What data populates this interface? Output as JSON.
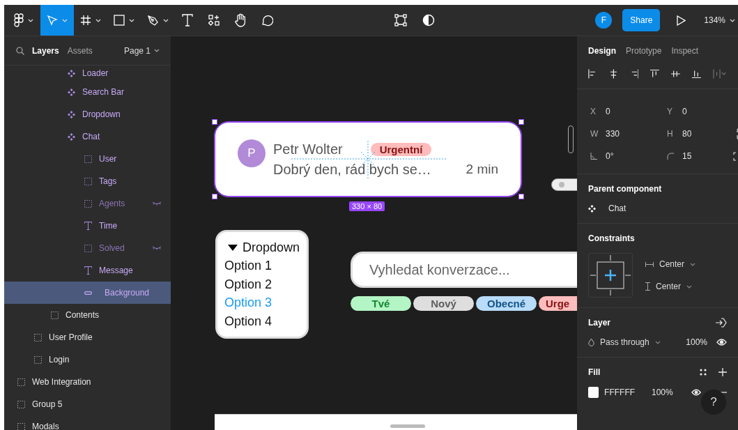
{
  "toolbar": {
    "tools": [
      {
        "kind": "main-menu",
        "menu": true,
        "selected": false
      },
      {
        "kind": "move",
        "menu": true,
        "selected": true
      },
      {
        "kind": "frame",
        "menu": true,
        "selected": false
      },
      {
        "kind": "shape",
        "menu": true,
        "selected": false
      },
      {
        "kind": "pen",
        "menu": true,
        "selected": false
      },
      {
        "kind": "text",
        "menu": false,
        "selected": false
      },
      {
        "kind": "resources",
        "menu": false,
        "selected": false
      },
      {
        "kind": "hand",
        "menu": false,
        "selected": false
      },
      {
        "kind": "comment",
        "menu": false,
        "selected": false
      }
    ],
    "user_initial": "F",
    "share_label": "Share",
    "zoom": "134%"
  },
  "sidebar": {
    "tabs": [
      {
        "label": "Layers",
        "selected": true
      },
      {
        "label": "Assets",
        "selected": false
      }
    ],
    "page": "Page 1",
    "layers": [
      {
        "children": [
          {
            "children": [
              {
                "children": [
                  {
                    "name": "Loader",
                    "kind": "component",
                    "hidden": false,
                    "selected": false
                  },
                  {
                    "name": "Search Bar",
                    "kind": "component",
                    "hidden": false,
                    "selected": false
                  },
                  {
                    "name": "Dropdown",
                    "kind": "component",
                    "hidden": false,
                    "selected": false
                  },
                  {
                    "name": "Chat",
                    "kind": "component",
                    "hidden": false,
                    "selected": false,
                    "children": [
                      {
                        "name": "User",
                        "kind": "frame",
                        "hidden": false,
                        "selected": false
                      },
                      {
                        "name": "Tags",
                        "kind": "frame",
                        "hidden": false,
                        "selected": false
                      },
                      {
                        "name": "Agents",
                        "kind": "frame",
                        "hidden": true,
                        "selected": false
                      },
                      {
                        "name": "Time",
                        "kind": "text",
                        "hidden": false,
                        "selected": false
                      },
                      {
                        "name": "Solved",
                        "kind": "frame",
                        "hidden": true,
                        "selected": false
                      },
                      {
                        "name": "Message",
                        "kind": "text",
                        "hidden": false,
                        "selected": false
                      },
                      {
                        "name": "Background",
                        "kind": "rectangle",
                        "hidden": false,
                        "selected": true
                      }
                    ]
                  }
                ]
              },
              {
                "name": "Contents",
                "kind": "frame",
                "hidden": false,
                "selected": false
              }
            ]
          },
          {
            "name": "User Profile",
            "kind": "frame",
            "hidden": false,
            "selected": false
          },
          {
            "name": "Login",
            "kind": "frame",
            "hidden": false,
            "selected": false
          }
        ]
      },
      {
        "name": "Web Integration",
        "kind": "frame",
        "hidden": false,
        "selected": false
      },
      {
        "name": "Group 5",
        "kind": "frame",
        "hidden": false,
        "selected": false
      },
      {
        "name": "Modals",
        "kind": "frame",
        "hidden": false,
        "selected": false
      }
    ]
  },
  "canvas": {
    "chat_card": {
      "avatar": "P",
      "name": "Petr Wolter",
      "tag": {
        "label": "Urgentní",
        "color": "#ffbcbc"
      },
      "message": "Dobrý den, rád bych se…",
      "time": "2 min",
      "selected": true,
      "size_label": "330 × 80"
    },
    "dropdown": {
      "title": "Dropdown",
      "options": [
        {
          "label": "Option 1",
          "selected": false
        },
        {
          "label": "Option 2",
          "selected": false
        },
        {
          "label": "Option 3",
          "selected": true
        },
        {
          "label": "Option 4",
          "selected": false
        }
      ]
    },
    "search": {
      "placeholder": "Vyhledat konverzace..."
    },
    "tags": [
      {
        "label": "Tvé",
        "color": "#b3f5c4"
      },
      {
        "label": "Nový",
        "color": "#dedede"
      },
      {
        "label": "Obecné",
        "color": "#b8dcfa"
      },
      {
        "label": "Urge",
        "color": "#ffbcbc"
      }
    ]
  },
  "design_panel": {
    "tabs": [
      {
        "label": "Design",
        "selected": true
      },
      {
        "label": "Prototype",
        "selected": false
      },
      {
        "label": "Inspect",
        "selected": false
      }
    ],
    "fields": [
      {
        "kind": "letter",
        "label": "X",
        "value": "0"
      },
      {
        "kind": "letter",
        "label": "Y",
        "value": "0"
      },
      {
        "kind": "letter",
        "label": "W",
        "value": "330"
      },
      {
        "kind": "letter",
        "label": "H",
        "value": "80"
      },
      {
        "kind": "rotation",
        "value": "0°"
      },
      {
        "kind": "radius",
        "value": "15"
      }
    ],
    "parent_component": {
      "title": "Parent component",
      "name": "Chat"
    },
    "constraints": {
      "title": "Constraints",
      "horizontal": "Center",
      "vertical": "Center"
    },
    "layer": {
      "title": "Layer",
      "blend": "Pass through",
      "opacity": "100%",
      "visible": true
    },
    "fill": {
      "title": "Fill",
      "hex": "FFFFFF",
      "opacity": "100%",
      "visible": true
    }
  },
  "help": "?"
}
